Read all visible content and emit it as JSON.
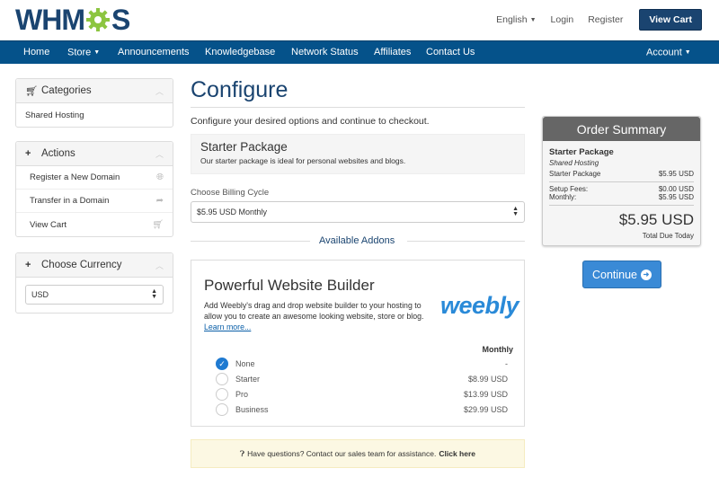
{
  "header": {
    "logo_text_left": "WHM",
    "logo_text_right": "S",
    "language": "English",
    "login": "Login",
    "register": "Register",
    "view_cart": "View Cart"
  },
  "nav": {
    "items": [
      "Home",
      "Store",
      "Announcements",
      "Knowledgebase",
      "Network Status",
      "Affiliates",
      "Contact Us"
    ],
    "account": "Account"
  },
  "sidebar": {
    "categories": {
      "title": "Categories",
      "items": [
        "Shared Hosting"
      ]
    },
    "actions": {
      "title": "Actions",
      "items": [
        "Register a New Domain",
        "Transfer in a Domain",
        "View Cart"
      ]
    },
    "currency": {
      "title": "Choose Currency",
      "value": "USD"
    }
  },
  "main": {
    "title": "Configure",
    "intro": "Configure your desired options and continue to checkout.",
    "package": {
      "name": "Starter Package",
      "description": "Our starter package is ideal for personal websites and blogs."
    },
    "billing": {
      "label": "Choose Billing Cycle",
      "value": "$5.95 USD Monthly"
    },
    "addons_title": "Available Addons",
    "addon": {
      "title": "Powerful Website Builder",
      "description": "Add Weebly's drag and drop website builder to your hosting to allow you to create an awesome looking website, store or blog.",
      "learn_more": "Learn more...",
      "brand": "weebly",
      "column_header": "Monthly",
      "options": [
        {
          "label": "None",
          "price": "-",
          "selected": true
        },
        {
          "label": "Starter",
          "price": "$8.99 USD",
          "selected": false
        },
        {
          "label": "Pro",
          "price": "$13.99 USD",
          "selected": false
        },
        {
          "label": "Business",
          "price": "$29.99 USD",
          "selected": false
        }
      ]
    },
    "help": {
      "text": "Have questions? Contact our sales team for assistance.",
      "link": "Click here"
    }
  },
  "summary": {
    "title": "Order Summary",
    "package": "Starter Package",
    "group": "Shared Hosting",
    "lines": [
      {
        "label": "Starter Package",
        "value": "$5.95 USD"
      },
      {
        "label": "Setup Fees:",
        "value": "$0.00 USD"
      },
      {
        "label": "Monthly:",
        "value": "$5.95 USD"
      }
    ],
    "total": "$5.95 USD",
    "total_label": "Total Due Today",
    "continue": "Continue"
  },
  "colors": {
    "brand_dark": "#1a4470",
    "nav_blue": "#05528a",
    "accent_blue": "#3a8ad6",
    "logo_gear_green": "#8cc540"
  }
}
